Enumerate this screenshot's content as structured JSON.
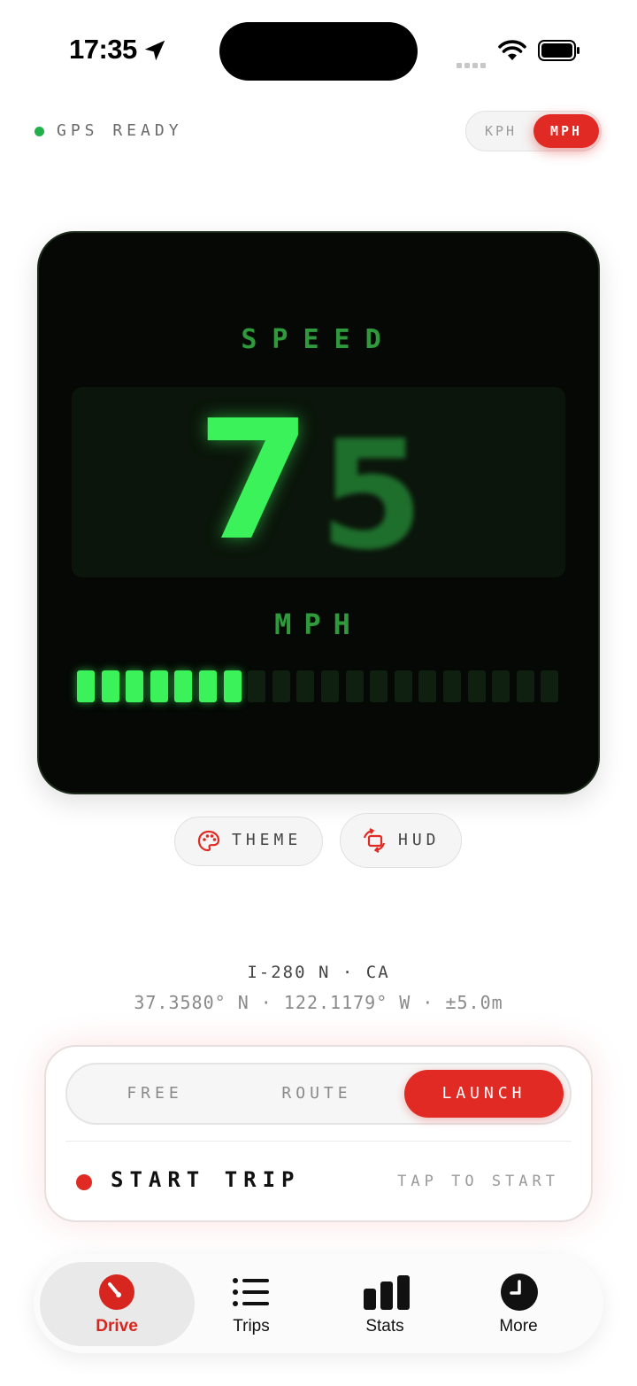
{
  "status_bar": {
    "time": "17:35",
    "icons": [
      "location-arrow-icon",
      "signal-icon",
      "wifi-icon",
      "battery-icon"
    ]
  },
  "gps": {
    "status": "GPS READY",
    "color": "#22b04c"
  },
  "units": {
    "options": [
      "KPH",
      "MPH"
    ],
    "selected": "MPH"
  },
  "speedometer": {
    "label": "SPEED",
    "digits": [
      "7",
      "5"
    ],
    "unit": "MPH",
    "bar_level": {
      "filled": 7,
      "total": 20
    },
    "colors": {
      "active": "#3cf25a",
      "label": "#2f9a3c",
      "background": "#050805"
    }
  },
  "controls": {
    "theme": {
      "label": "THEME",
      "icon": "palette-icon"
    },
    "hud": {
      "label": "HUD",
      "icon": "rotate-screen-icon"
    }
  },
  "location": {
    "road": "I-280 N · CA",
    "coords": "37.3580° N · 122.1179° W · ±5.0m"
  },
  "trip": {
    "modes": [
      "FREE",
      "ROUTE",
      "LAUNCH"
    ],
    "selected_mode": "LAUNCH",
    "start_label": "START TRIP",
    "hint": "TAP TO START",
    "accent": "#e02a23"
  },
  "tabbar": {
    "selected": "Drive",
    "tabs": [
      {
        "label": "Drive",
        "icon": "speedometer-icon"
      },
      {
        "label": "Trips",
        "icon": "list-icon"
      },
      {
        "label": "Stats",
        "icon": "bar-chart-icon"
      },
      {
        "label": "More",
        "icon": "clock-icon"
      }
    ]
  }
}
